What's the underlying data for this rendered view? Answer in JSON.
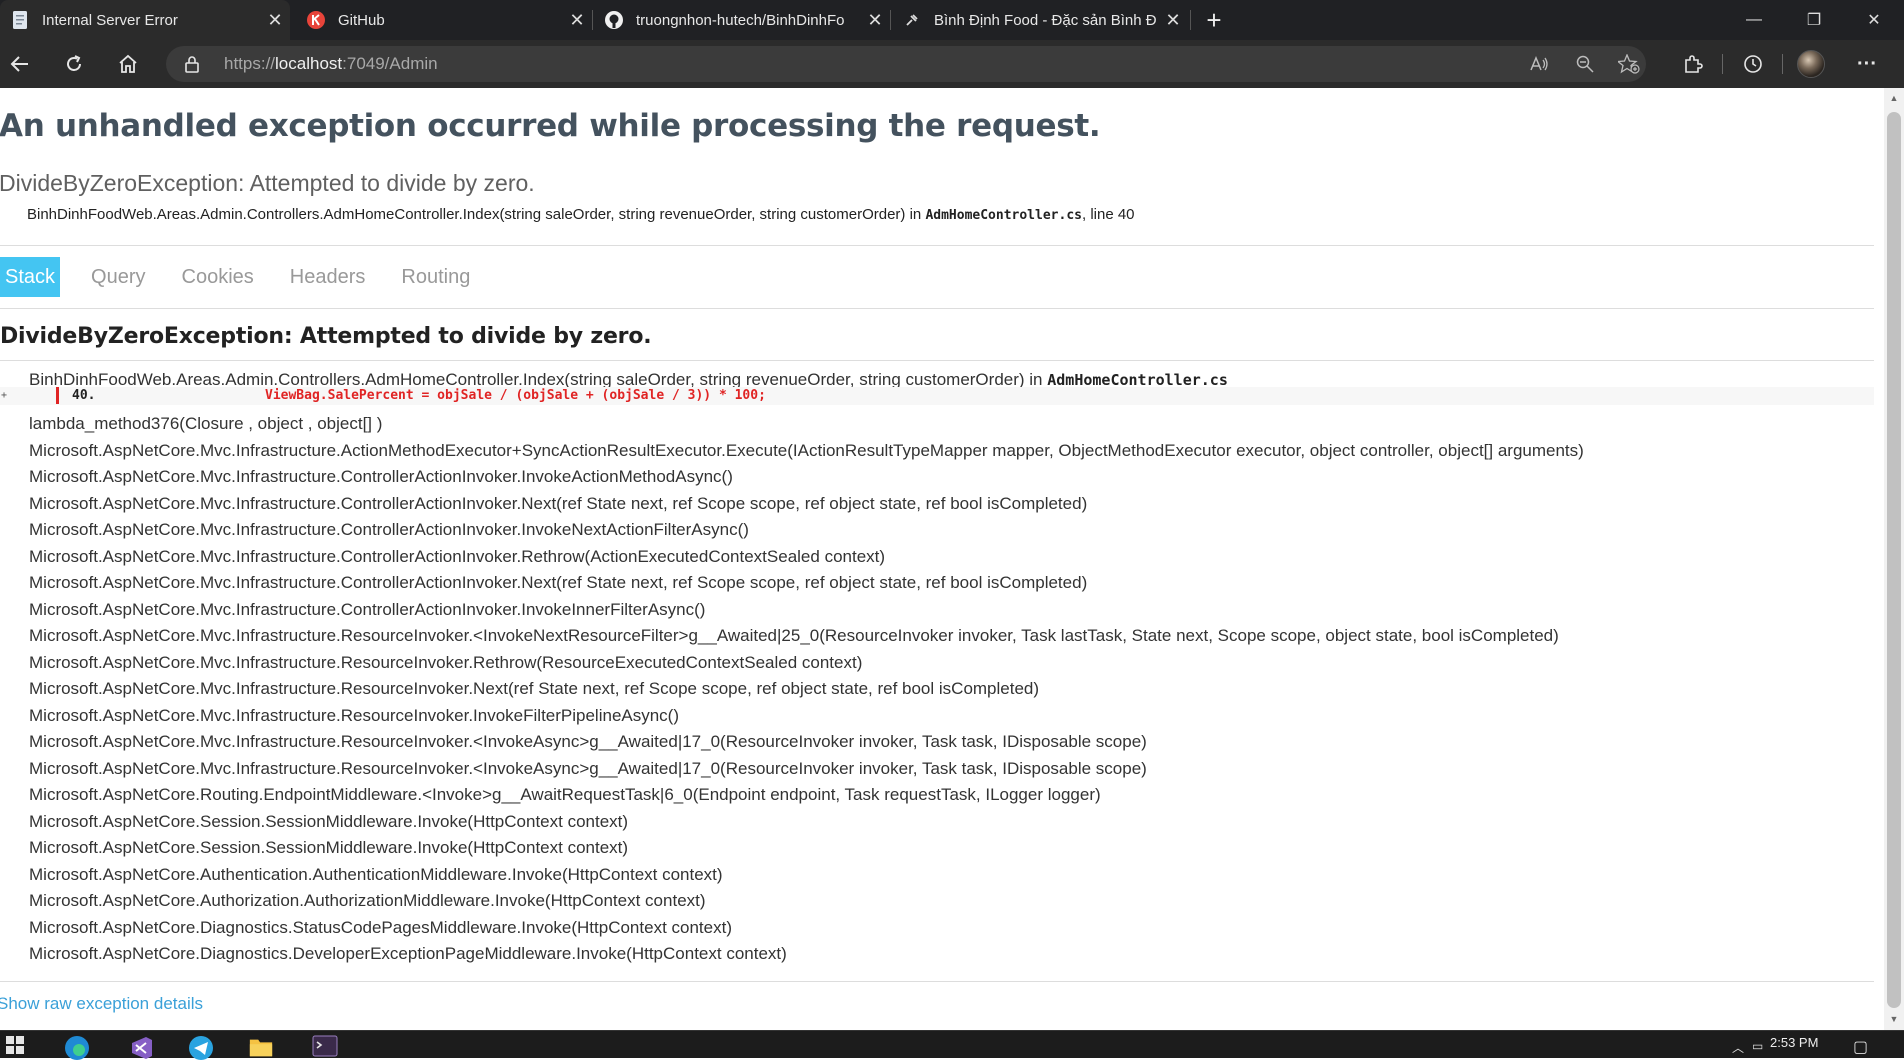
{
  "browser": {
    "tabs": [
      {
        "title": "Internal Server Error",
        "favicon": "page-icon",
        "active": true
      },
      {
        "title": "GitHub",
        "favicon": "github-alt-icon",
        "active": false
      },
      {
        "title": "truongnhon-hutech/BinhDinhFo",
        "favicon": "github-icon",
        "active": false
      },
      {
        "title": "Bình Định Food - Đặc sản Bình Đ",
        "favicon": "pin-icon",
        "active": false
      }
    ],
    "close_glyph": "✕",
    "new_tab_glyph": "+",
    "address": {
      "scheme": "https://",
      "host": "localhost",
      "rest": ":7049/Admin"
    },
    "window_controls": {
      "minimize": "—",
      "maximize": "❐",
      "close": "✕"
    },
    "menu_glyph": "···"
  },
  "page": {
    "title": "An unhandled exception occurred while processing the request.",
    "subtitle": "DivideByZeroException: Attempted to divide by zero.",
    "location": "BinhDinhFoodWeb.Areas.Admin.Controllers.AdmHomeController.Index(string saleOrder, string revenueOrder, string customerOrder) in ",
    "location_file": "AdmHomeController.cs",
    "location_line": ", line 40",
    "tabs": [
      "Stack",
      "Query",
      "Cookies",
      "Headers",
      "Routing"
    ],
    "exception_heading": "DivideByZeroException: Attempted to divide by zero.",
    "first_frame": "BinhDinhFoodWeb.Areas.Admin.Controllers.AdmHomeController.Index(string saleOrder, string revenueOrder, string customerOrder) in ",
    "first_frame_file": "AdmHomeController.cs",
    "source": {
      "expand_glyph": "+",
      "line_number": "40.",
      "code": "ViewBag.SalePercent = objSale / (objSale + (objSale / 3)) * 100;"
    },
    "frames": [
      "lambda_method376(Closure , object , object[] )",
      "Microsoft.AspNetCore.Mvc.Infrastructure.ActionMethodExecutor+SyncActionResultExecutor.Execute(IActionResultTypeMapper mapper, ObjectMethodExecutor executor, object controller, object[] arguments)",
      "Microsoft.AspNetCore.Mvc.Infrastructure.ControllerActionInvoker.InvokeActionMethodAsync()",
      "Microsoft.AspNetCore.Mvc.Infrastructure.ControllerActionInvoker.Next(ref State next, ref Scope scope, ref object state, ref bool isCompleted)",
      "Microsoft.AspNetCore.Mvc.Infrastructure.ControllerActionInvoker.InvokeNextActionFilterAsync()",
      "Microsoft.AspNetCore.Mvc.Infrastructure.ControllerActionInvoker.Rethrow(ActionExecutedContextSealed context)",
      "Microsoft.AspNetCore.Mvc.Infrastructure.ControllerActionInvoker.Next(ref State next, ref Scope scope, ref object state, ref bool isCompleted)",
      "Microsoft.AspNetCore.Mvc.Infrastructure.ControllerActionInvoker.InvokeInnerFilterAsync()",
      "Microsoft.AspNetCore.Mvc.Infrastructure.ResourceInvoker.<InvokeNextResourceFilter>g__Awaited|25_0(ResourceInvoker invoker, Task lastTask, State next, Scope scope, object state, bool isCompleted)",
      "Microsoft.AspNetCore.Mvc.Infrastructure.ResourceInvoker.Rethrow(ResourceExecutedContextSealed context)",
      "Microsoft.AspNetCore.Mvc.Infrastructure.ResourceInvoker.Next(ref State next, ref Scope scope, ref object state, ref bool isCompleted)",
      "Microsoft.AspNetCore.Mvc.Infrastructure.ResourceInvoker.InvokeFilterPipelineAsync()",
      "Microsoft.AspNetCore.Mvc.Infrastructure.ResourceInvoker.<InvokeAsync>g__Awaited|17_0(ResourceInvoker invoker, Task task, IDisposable scope)",
      "Microsoft.AspNetCore.Mvc.Infrastructure.ResourceInvoker.<InvokeAsync>g__Awaited|17_0(ResourceInvoker invoker, Task task, IDisposable scope)",
      "Microsoft.AspNetCore.Routing.EndpointMiddleware.<Invoke>g__AwaitRequestTask|6_0(Endpoint endpoint, Task requestTask, ILogger logger)",
      "Microsoft.AspNetCore.Session.SessionMiddleware.Invoke(HttpContext context)",
      "Microsoft.AspNetCore.Session.SessionMiddleware.Invoke(HttpContext context)",
      "Microsoft.AspNetCore.Authentication.AuthenticationMiddleware.Invoke(HttpContext context)",
      "Microsoft.AspNetCore.Authorization.AuthorizationMiddleware.Invoke(HttpContext context)",
      "Microsoft.AspNetCore.Diagnostics.StatusCodePagesMiddleware.Invoke(HttpContext context)",
      "Microsoft.AspNetCore.Diagnostics.DeveloperExceptionPageMiddleware.Invoke(HttpContext context)"
    ],
    "raw_link": "Show raw exception details"
  },
  "taskbar": {
    "clock": "2:53 PM",
    "apps": [
      "windows-start-icon",
      "edge-icon",
      "visual-studio-icon",
      "telegram-icon",
      "file-explorer-icon",
      "terminal-icon"
    ]
  },
  "colors": {
    "accent_tab": "#44c5f2",
    "error_red": "#e02424",
    "link": "#3aa0d8",
    "title": "#44525e"
  }
}
